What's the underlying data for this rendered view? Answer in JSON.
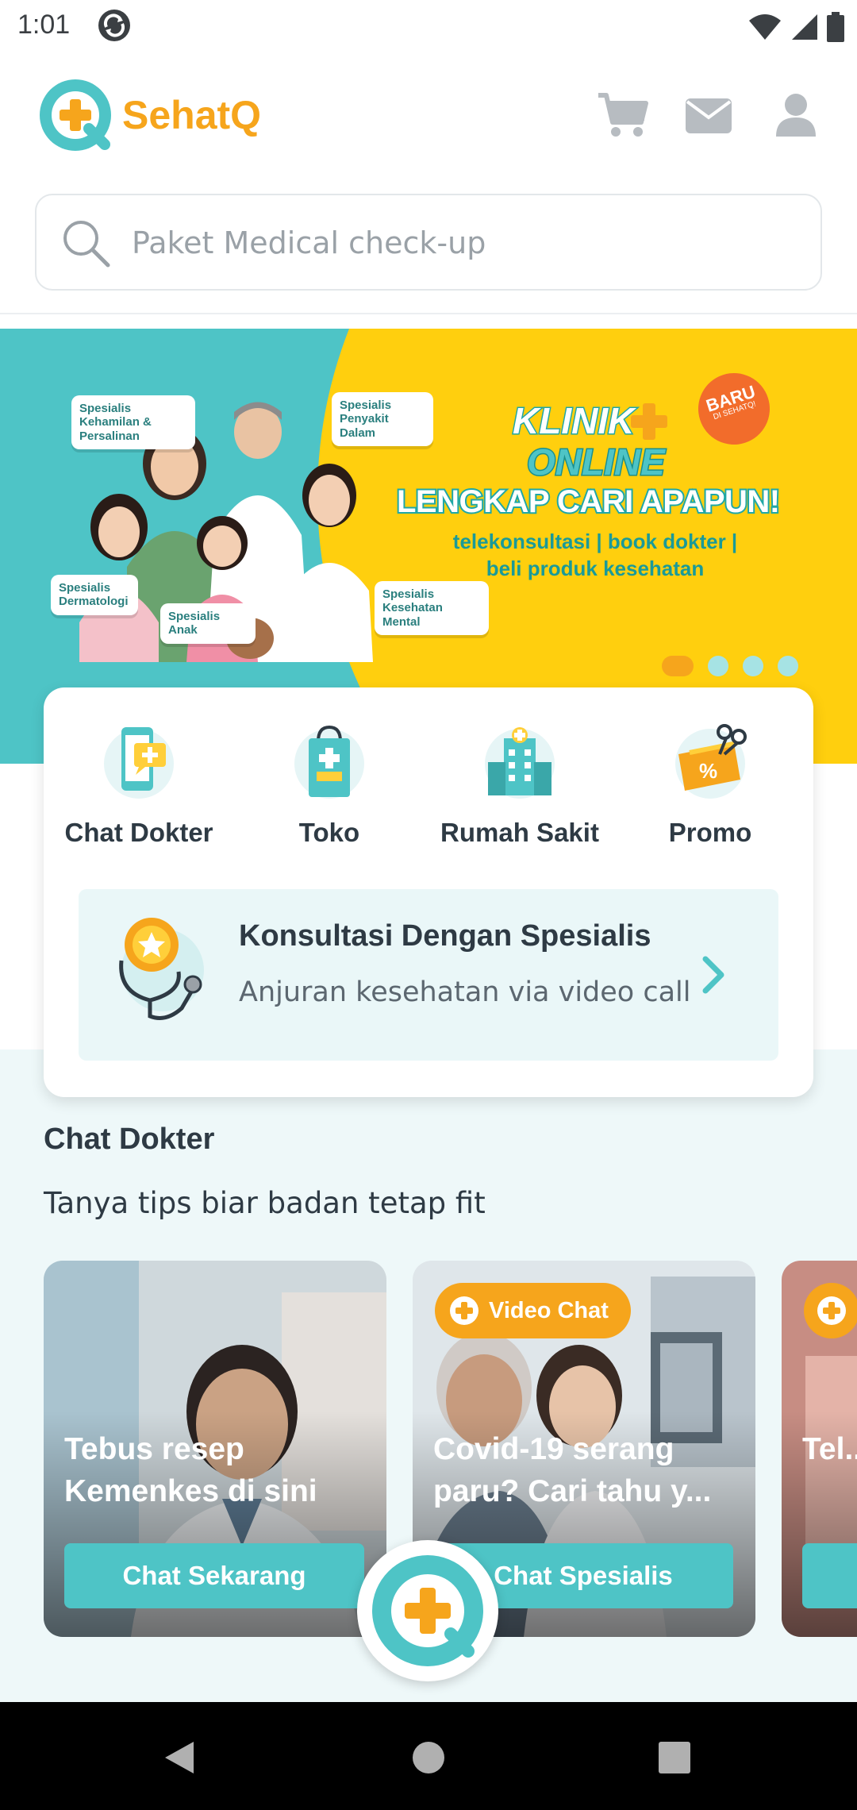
{
  "status_bar": {
    "time": "1:01"
  },
  "app": {
    "name": "SehatQ"
  },
  "search": {
    "placeholder": "Paket Medical check-up"
  },
  "banner": {
    "klinik_line1": "KLINIK",
    "klinik_line2": "ONLINE",
    "badge_line1": "BARU",
    "badge_line2": "DI SEHATQ!",
    "headline": "LENGKAP CARI APAPUN!",
    "tagline_line1": "telekonsultasi | book dokter |",
    "tagline_line2": "beli produk kesehatan",
    "bubbles": {
      "kehamilan": "Spesialis Kehamilan & Persalinan",
      "penyakit_dalam": "Spesialis Penyakit Dalam",
      "dermatologi": "Spesialis Dermatologi",
      "anak": "Spesialis Anak",
      "kesehatan_mental": "Spesialis Kesehatan Mental"
    },
    "slide_count": 4,
    "active_slide": 1
  },
  "menu": {
    "items": [
      {
        "label": "Chat Dokter",
        "icon": "phone-chat-icon"
      },
      {
        "label": "Toko",
        "icon": "shopping-bag-icon"
      },
      {
        "label": "Rumah Sakit",
        "icon": "hospital-icon"
      },
      {
        "label": "Promo",
        "icon": "promo-ticket-icon"
      }
    ]
  },
  "specialist": {
    "title": "Konsultasi Dengan Spesialis",
    "subtitle": "Anjuran kesehatan via video call"
  },
  "chat_section": {
    "title": "Chat Dokter",
    "subtitle": "Tanya tips biar badan tetap fit",
    "cards": [
      {
        "title": "Tebus resep Kemenkes di sini",
        "button": "Chat Sekarang",
        "badge": ""
      },
      {
        "title": "Covid-19 serang paru? Cari tahu y...",
        "button": "Chat Spesialis",
        "badge": "Video Chat"
      },
      {
        "title": "Tel... har...",
        "button": "",
        "badge": ""
      }
    ]
  },
  "colors": {
    "brand_teal": "#4ec4c6",
    "brand_orange": "#f6a51c",
    "banner_yellow": "#ffcf0e"
  }
}
